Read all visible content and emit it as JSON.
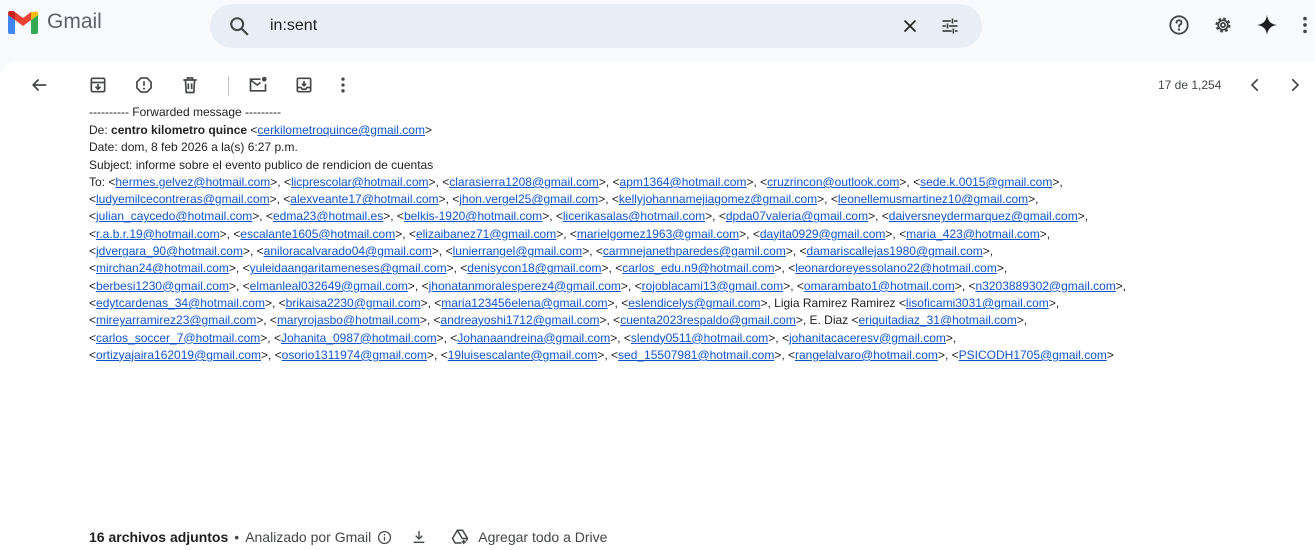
{
  "app": {
    "name": "Gmail"
  },
  "search": {
    "value": "in:sent"
  },
  "pagination": {
    "text": "17 de 1,254"
  },
  "email": {
    "clipped_line": "---------- Forwarded message ---------",
    "from_label": "De: ",
    "from_name": "centro kilometro quince",
    "from_email": "cerkilometroquince@gmail.com",
    "date_line": "Date: dom, 8 feb 2026 a la(s) 6:27 p.m.",
    "subject_line": "Subject: informe sobre el evento publico de rendicion de cuentas",
    "to_label": "To: ",
    "to_rows": [
      [
        {
          "e": "hermes.gelvez@hotmail.com"
        },
        {
          "e": "licprescolar@hotmail.com"
        },
        {
          "e": "clarasierra1208@gmail.com"
        },
        {
          "e": "apm1364@hotmail.com"
        },
        {
          "e": "cruzrincon@outlook.com"
        },
        {
          "e": "sede.k.0015@gmail.com"
        }
      ],
      [
        {
          "e": "ludyemilcecontreras@gmail.com"
        },
        {
          "e": "alexveante17@hotmail.com"
        },
        {
          "e": "jhon.vergel25@gmail.com"
        },
        {
          "e": "kellyjohannamejiagomez@gmail.com"
        },
        {
          "e": "leonellemusmartinez10@gmail.com"
        }
      ],
      [
        {
          "e": "julian_caycedo@hotmail.com"
        },
        {
          "e": "edma23@hotmail.es"
        },
        {
          "e": "belkis-1920@hotmail.com"
        },
        {
          "e": "licerikasalas@hotmail.com"
        },
        {
          "e": "dpda07valeria@gmail.com"
        },
        {
          "e": "daiversneydermarquez@gmail.com"
        }
      ],
      [
        {
          "e": "r.a.b.r.19@hotmail.com"
        },
        {
          "e": "escalante1605@hotmail.com"
        },
        {
          "e": "elizaibanez71@gmail.com"
        },
        {
          "e": "marielgomez1963@gmail.com"
        },
        {
          "e": "dayita0929@gmail.com"
        },
        {
          "e": "maria_423@hotmail.com"
        }
      ],
      [
        {
          "e": "jdvergara_90@hotmail.com"
        },
        {
          "e": "aniloracalvarado04@gmail.com"
        },
        {
          "e": "lunierrangel@gmail.com"
        },
        {
          "e": "carmnejanethparedes@gamil.com"
        },
        {
          "e": "damariscallejas1980@gmail.com"
        }
      ],
      [
        {
          "e": "mirchan24@hotmail.com"
        },
        {
          "e": "yuleidaangaritameneses@gmail.com"
        },
        {
          "e": "denisycon18@gmail.com"
        },
        {
          "e": "carlos_edu.n9@hotmail.com"
        },
        {
          "e": "leonardoreyessolano22@hotmail.com"
        }
      ],
      [
        {
          "e": "berbesi1230@gmail.com"
        },
        {
          "e": "elmanleal032649@gmail.com"
        },
        {
          "e": "jhonatanmoralesperez4@gmail.com"
        },
        {
          "e": "rojoblacami13@gmail.com"
        },
        {
          "e": "omarambato1@hotmail.com"
        },
        {
          "e": "n3203889302@gmail.com"
        }
      ],
      [
        {
          "e": "edytcardenas_34@hotmail.com"
        },
        {
          "e": "brikaisa2230@gmail.com"
        },
        {
          "e": "maria123456elena@gmail.com"
        },
        {
          "e": "eslendicelys@gmail.com"
        },
        {
          "n": "Ligia Ramirez Ramirez",
          "e": "lisoficami3031@gmail.com"
        }
      ],
      [
        {
          "e": "mireyarramirez23@gmail.com"
        },
        {
          "e": "maryrojasbo@hotmail.com"
        },
        {
          "e": "andreayoshi1712@gmail.com"
        },
        {
          "e": "cuenta2023respaldo@gmail.com"
        },
        {
          "n": "E. Diaz",
          "e": "eriquitadiaz_31@hotmail.com"
        }
      ],
      [
        {
          "e": "carlos_soccer_7@hotmail.com"
        },
        {
          "e": "Johanita_0987@hotmail.com"
        },
        {
          "e": "Johanaandreina@gmail.com"
        },
        {
          "e": "slendy0511@hotmail.com"
        },
        {
          "e": "johanitacaceresv@gmail.com"
        }
      ],
      [
        {
          "e": "ortizyajaira162019@gmail.com"
        },
        {
          "e": "osorio1311974@gmail.com"
        },
        {
          "e": "19luisescalante@gmail.com"
        },
        {
          "e": "sed_15507981@hotmail.com"
        },
        {
          "e": "rangelalvaro@hotmail.com"
        },
        {
          "e": "PSICODH1705@gmail.com"
        }
      ]
    ],
    "attachments": {
      "count_label": "16 archivos adjuntos",
      "separator": "•",
      "scanned_label": "Analizado por Gmail",
      "drive_label": "Agregar todo a Drive"
    }
  },
  "icons": {
    "back": "back-arrow-icon",
    "archive": "archive-icon",
    "spam": "report-spam-icon",
    "delete": "delete-icon",
    "unread": "mark-unread-icon",
    "move": "move-to-icon",
    "more": "more-vert-icon",
    "help": "help-icon",
    "settings": "settings-icon",
    "gemini": "gemini-sparkle-icon"
  },
  "colors": {
    "link": "#1155cc",
    "search_bg": "#e9eef6",
    "app_bg": "#f8fafd"
  }
}
